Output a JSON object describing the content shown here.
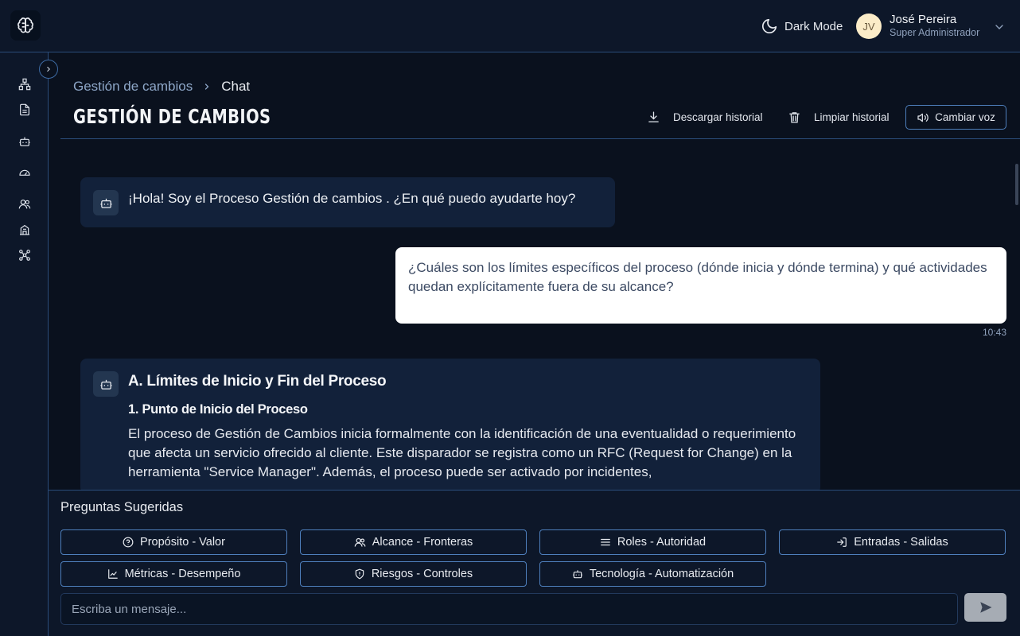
{
  "header": {
    "logo_icon": "brain-icon",
    "dark_mode_label": "Dark Mode",
    "user": {
      "initials": "JV",
      "name": "José Pereira",
      "role": "Super Administrador"
    }
  },
  "sidebar": {
    "items": [
      {
        "icon": "sitemap-icon"
      },
      {
        "icon": "document-icon"
      },
      {
        "icon": "robot-icon"
      },
      {
        "icon": "gauge-icon"
      },
      {
        "icon": "users-icon"
      },
      {
        "icon": "building-icon"
      },
      {
        "icon": "network-icon"
      }
    ]
  },
  "page": {
    "breadcrumb": {
      "parent": "Gestión de cambios",
      "current": "Chat"
    },
    "title": "GESTIÓN DE CAMBIOS",
    "actions": {
      "download": "Descargar historial",
      "clear": "Limpiar historial",
      "voice": "Cambiar voz"
    }
  },
  "chat": {
    "greeting": "¡Hola! Soy el Proceso Gestión de cambios . ¿En qué puedo ayudarte hoy?",
    "user_message": "¿Cuáles son los límites específicos del proceso (dónde inicia y dónde termina) y qué actividades quedan explícitamente fuera de su alcance?",
    "user_time": "10:43",
    "reply": {
      "heading": "A. Límites de Inicio y Fin del Proceso",
      "subheading": "1. Punto de Inicio del Proceso",
      "paragraph": "El proceso de Gestión de Cambios inicia formalmente con la identificación de una eventualidad o requerimiento que afecta un servicio ofrecido al cliente. Este disparador se registra como un RFC (Request for Change) en la herramienta \"Service Manager\". Además, el proceso puede ser activado por incidentes,"
    }
  },
  "suggestions": {
    "title": "Preguntas Sugeridas",
    "chips": [
      {
        "label": "Propósito - Valor",
        "icon": "help-circle-icon"
      },
      {
        "label": "Alcance - Fronteras",
        "icon": "users-icon"
      },
      {
        "label": "Roles - Autoridad",
        "icon": "list-icon"
      },
      {
        "label": "Entradas - Salidas",
        "icon": "login-icon"
      },
      {
        "label": "Métricas - Desempeño",
        "icon": "chart-line-icon"
      },
      {
        "label": "Riesgos - Controles",
        "icon": "shield-icon"
      },
      {
        "label": "Tecnología - Automatización",
        "icon": "robot-icon"
      }
    ]
  },
  "composer": {
    "placeholder": "Escriba un mensaje..."
  }
}
